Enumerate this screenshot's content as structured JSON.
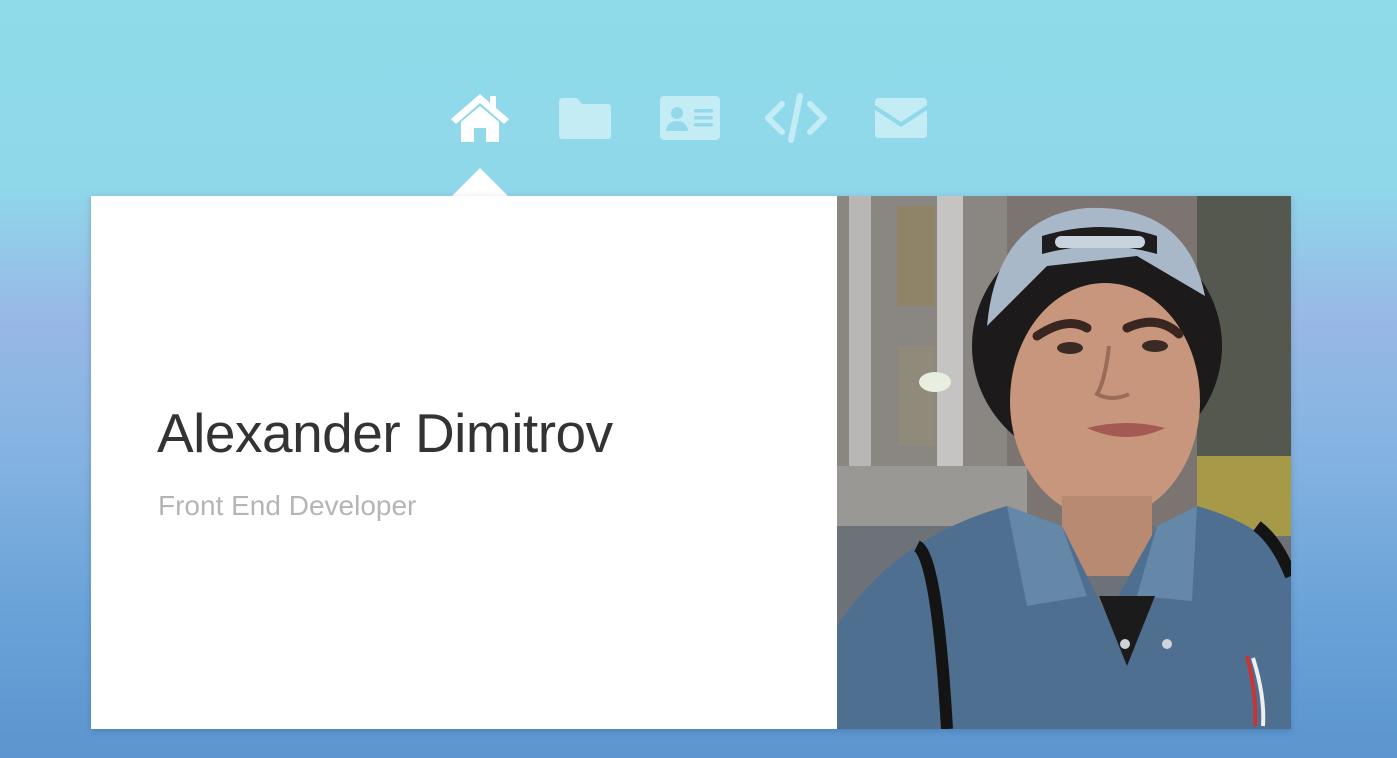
{
  "nav": {
    "items": [
      {
        "id": "home",
        "icon": "home-icon",
        "active": true
      },
      {
        "id": "projects",
        "icon": "folder-icon",
        "active": false
      },
      {
        "id": "about",
        "icon": "id-card-icon",
        "active": false
      },
      {
        "id": "code",
        "icon": "code-icon",
        "active": false
      },
      {
        "id": "contact",
        "icon": "envelope-icon",
        "active": false
      }
    ]
  },
  "profile": {
    "name": "Alexander Dimitrov",
    "title": "Front End Developer",
    "photo": "portrait-photo"
  },
  "colors": {
    "background_top": "#8fdbe9",
    "background_bottom": "#5c95cf",
    "name_text": "#333333",
    "title_text": "#b5b5b5",
    "active_icon": "#ffffff",
    "inactive_icon": "#c4ecf5"
  }
}
